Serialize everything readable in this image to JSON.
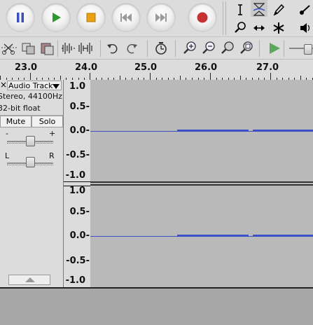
{
  "toolbar": {
    "transport": [
      {
        "name": "pause",
        "icon": "pause-icon"
      },
      {
        "name": "play",
        "icon": "play-icon"
      },
      {
        "name": "stop",
        "icon": "stop-icon"
      },
      {
        "name": "skip-start",
        "icon": "skip-to-start-icon"
      },
      {
        "name": "skip-end",
        "icon": "skip-to-end-icon"
      },
      {
        "name": "record",
        "icon": "record-icon"
      }
    ],
    "tools": [
      "selection-tool-icon",
      "envelope-tool-icon",
      "draw-tool-icon",
      "record-meter-icon",
      "zoom-tool-icon",
      "time-shift-tool-icon",
      "multi-tool-icon",
      "playback-meter-icon"
    ],
    "edit": [
      "cut-icon",
      "copy-icon",
      "paste-icon",
      "trim-icon",
      "silence-icon",
      "undo-icon",
      "redo-icon",
      "sync-lock-icon",
      "zoom-in-icon",
      "zoom-out-icon",
      "fit-selection-icon",
      "fit-project-icon",
      "play-at-speed-icon"
    ]
  },
  "ruler": {
    "labels": [
      "23.0",
      "24.0",
      "25.0",
      "26.0",
      "27.0"
    ]
  },
  "track": {
    "close_label": "×",
    "name": "Audio Track",
    "format_line": "Stereo, 44100Hz",
    "bit_depth": "32-bit float",
    "mute_label": "Mute",
    "solo_label": "Solo",
    "gain_minus": "-",
    "gain_plus": "+",
    "pan_left": "L",
    "pan_right": "R",
    "gain_level": 0.5,
    "pan_level": 0.5
  },
  "scale": {
    "labels": [
      "1.0",
      "0.5-",
      "0.0-",
      "-0.5-",
      "-1.0"
    ]
  },
  "colors": {
    "waveform": "#3b4fc7",
    "waveform_background": "#b9b9b9",
    "record_red": "#c43232",
    "transport_blue": "#3c4fbf",
    "transport_green": "#2e9b2e",
    "stop_orange": "#e8a214"
  }
}
